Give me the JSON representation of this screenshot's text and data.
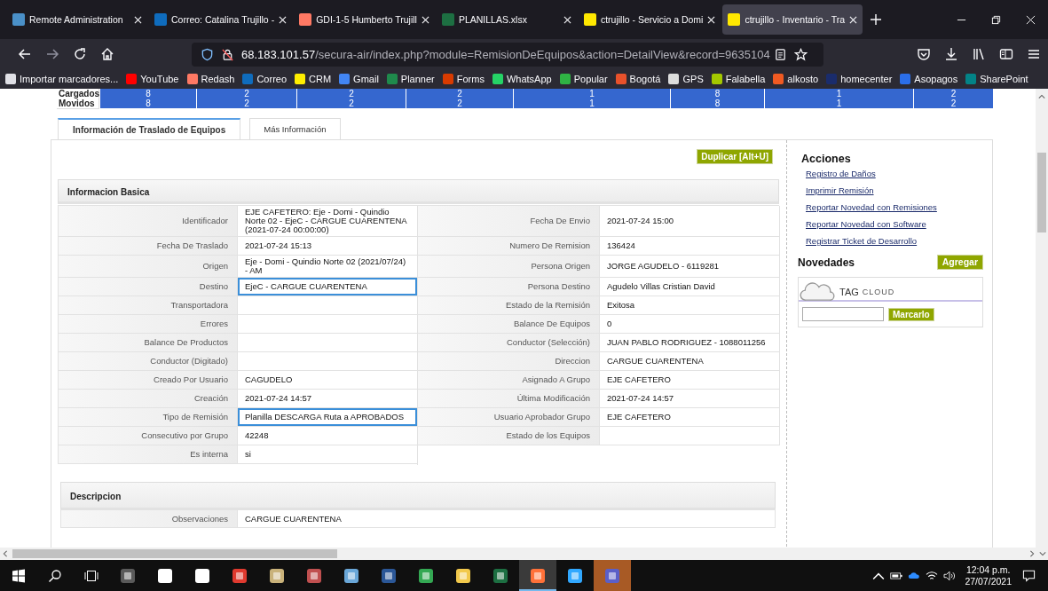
{
  "browser": {
    "tabs": [
      {
        "title": "Remote Administration",
        "selected": false,
        "color": "#4a90c8"
      },
      {
        "title": "Correo: Catalina Trujillo -",
        "selected": false,
        "color": "#0f6cbd"
      },
      {
        "title": "GDI-1-5 Humberto Trujill",
        "selected": false,
        "color": "#ff7964"
      },
      {
        "title": "PLANILLAS.xlsx",
        "selected": false,
        "color": "#1d6f42"
      },
      {
        "title": "ctrujillo - Servicio a Domi",
        "selected": false,
        "color": "#ffe800"
      },
      {
        "title": "ctrujillo - Inventario - Tra",
        "selected": true,
        "color": "#ffe800"
      }
    ],
    "url": {
      "host": "68.183.101.57",
      "path": "/secura-air/index.php?module=RemisionDeEquipos&action=DetailView&record=9635104"
    },
    "bookmarks": [
      {
        "label": "Importar marcadores...",
        "color": "#e0e0e6"
      },
      {
        "label": "YouTube",
        "color": "#ff0000"
      },
      {
        "label": "Redash",
        "color": "#ff7964"
      },
      {
        "label": "Correo",
        "color": "#0f6cbd"
      },
      {
        "label": "CRM",
        "color": "#ffee00"
      },
      {
        "label": "Gmail",
        "color": "#4285f4"
      },
      {
        "label": "Planner",
        "color": "#1f8a4c"
      },
      {
        "label": "Forms",
        "color": "#d83b01"
      },
      {
        "label": "WhatsApp",
        "color": "#25d366"
      },
      {
        "label": "Popular",
        "color": "#2fb344"
      },
      {
        "label": "Bogotá",
        "color": "#e8512b"
      },
      {
        "label": "GPS",
        "color": "#dddddd"
      },
      {
        "label": "Falabella",
        "color": "#a4c800"
      },
      {
        "label": "alkosto",
        "color": "#f05a22"
      },
      {
        "label": "homecenter",
        "color": "#1a2c6c"
      },
      {
        "label": "Asopagos",
        "color": "#2b6ee8"
      },
      {
        "label": "SharePoint",
        "color": "#038387"
      }
    ]
  },
  "summary": {
    "rows": [
      {
        "label": "Cargados",
        "values": [
          "8",
          "2",
          "2",
          "2",
          "1",
          "8",
          "1",
          "2"
        ]
      },
      {
        "label": "Movidos",
        "values": [
          "8",
          "2",
          "2",
          "2",
          "1",
          "8",
          "1",
          "2"
        ]
      }
    ]
  },
  "page_tabs": [
    {
      "label": "Información de Traslado de Equipos",
      "selected": true
    },
    {
      "label": "Más Información",
      "selected": false
    }
  ],
  "duplicate_button": "Duplicar [Alt+U]",
  "basic_info": {
    "title": "Informacion Basica",
    "rows": [
      {
        "left": {
          "label": "Identificador",
          "value": "EJE CAFETERO: Eje - Domi - Quindio Norte 02 - EjeC - CARGUE CUARENTENA (2021-07-24 00:00:00)",
          "highlighted": false
        },
        "right": {
          "label": "Fecha De Envio",
          "value": "2021-07-24 15:00"
        }
      },
      {
        "left": {
          "label": "Fecha De Traslado",
          "value": "2021-07-24 15:13",
          "highlighted": false
        },
        "right": {
          "label": "Numero De Remision",
          "value": "136424"
        }
      },
      {
        "left": {
          "label": "Origen",
          "value": "Eje - Domi - Quindio Norte 02 (2021/07/24) - AM",
          "highlighted": false
        },
        "right": {
          "label": "Persona Origen",
          "value": "JORGE AGUDELO - 6119281"
        }
      },
      {
        "left": {
          "label": "Destino",
          "value": "EjeC - CARGUE CUARENTENA",
          "highlighted": true
        },
        "right": {
          "label": "Persona Destino",
          "value": "Agudelo Villas Cristian David"
        }
      },
      {
        "left": {
          "label": "Transportadora",
          "highlighted": false
        },
        "right": {
          "label": "Estado de la Remisión",
          "value": "Exitosa"
        }
      },
      {
        "left": {
          "label": "Errores",
          "highlighted": false
        },
        "right": {
          "label": "Balance De Equipos",
          "value": "0"
        }
      },
      {
        "left": {
          "label": "Balance De Productos",
          "highlighted": false
        },
        "right": {
          "label": "Conductor (Selección)",
          "value": "JUAN PABLO RODRIGUEZ - 1088011256"
        }
      },
      {
        "left": {
          "label": "Conductor (Digitado)",
          "highlighted": false
        },
        "right": {
          "label": "Direccion",
          "value": "CARGUE CUARENTENA"
        }
      },
      {
        "left": {
          "label": "Creado Por Usuario",
          "value": "CAGUDELO",
          "highlighted": false
        },
        "right": {
          "label": "Asignado A Grupo",
          "value": "EJE CAFETERO"
        }
      },
      {
        "left": {
          "label": "Creación",
          "value": "2021-07-24 14:57",
          "highlighted": false
        },
        "right": {
          "label": "Última Modificación",
          "value": "2021-07-24 14:57"
        }
      },
      {
        "left": {
          "label": "Tipo de Remisión",
          "value": "Planilla DESCARGA Ruta a APROBADOS",
          "highlighted": true
        },
        "right": {
          "label": "Usuario Aprobador Grupo",
          "value": "EJE CAFETERO"
        }
      },
      {
        "left": {
          "label": "Consecutivo por Grupo",
          "value": "42248",
          "highlighted": false
        },
        "right": {
          "label": "Estado de los Equipos"
        }
      },
      {
        "left": {
          "label": "Es interna",
          "value": "si",
          "highlighted": false
        }
      }
    ]
  },
  "description": {
    "title": "Descripcion",
    "rows": [
      {
        "label": "Observaciones",
        "value": "CARGUE CUARENTENA"
      }
    ]
  },
  "actions": {
    "title": "Acciones",
    "links": [
      "Registro de Daños",
      "Imprimir Remisión",
      "Reportar Novedad con Remisiones",
      "Reportar Novedad con Software",
      "Registrar Ticket de Desarrollo"
    ]
  },
  "news": {
    "title": "Novedades",
    "add_button": "Agregar",
    "tag_cloud": {
      "tag": "TAG",
      "cloud": "CLOUD",
      "button": "Marcarlo"
    }
  },
  "taskbar": {
    "apps": [
      {
        "kind": "calculator",
        "selected": false,
        "flashing": false
      },
      {
        "kind": "camera",
        "selected": false,
        "flashing": false
      },
      {
        "kind": "calendar",
        "selected": false,
        "flashing": false
      },
      {
        "kind": "remote",
        "selected": false,
        "flashing": false
      },
      {
        "kind": "pdf",
        "selected": false,
        "flashing": false
      },
      {
        "kind": "snip",
        "selected": false,
        "flashing": false
      },
      {
        "kind": "paint",
        "selected": false,
        "flashing": false
      },
      {
        "kind": "word",
        "selected": false,
        "flashing": false
      },
      {
        "kind": "chrome",
        "selected": false,
        "flashing": false
      },
      {
        "kind": "folder",
        "selected": false,
        "flashing": false
      },
      {
        "kind": "excel",
        "selected": false,
        "flashing": false
      },
      {
        "kind": "firefox",
        "selected": true,
        "flashing": false
      },
      {
        "kind": "lightroom",
        "selected": false,
        "flashing": false
      },
      {
        "kind": "teams",
        "selected": false,
        "flashing": true
      }
    ],
    "time": "12:04 p.m.",
    "date": "27/07/2021"
  }
}
